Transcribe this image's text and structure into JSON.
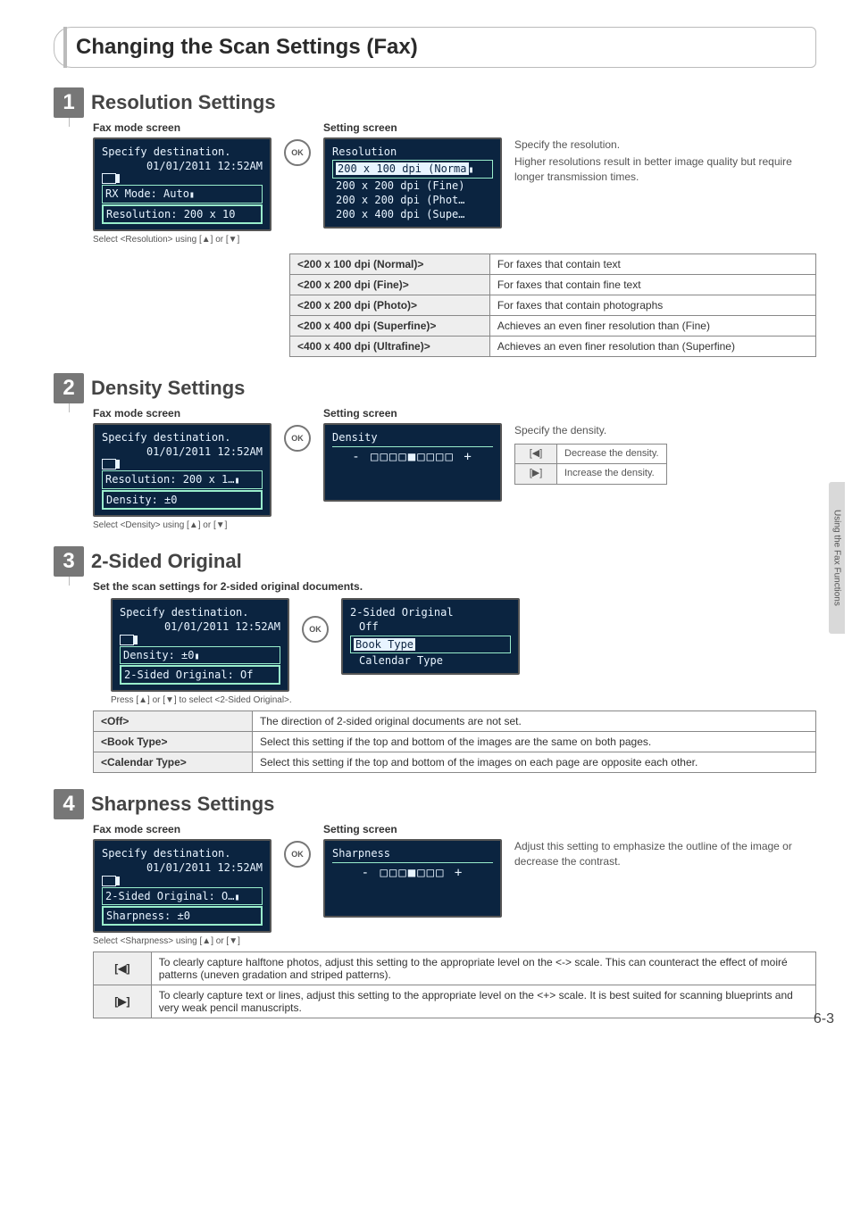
{
  "side_tab": "Using the Fax Functions",
  "page_number": "6-3",
  "main_title": "Changing the Scan Settings (Fax)",
  "steps": {
    "s1": {
      "num": "1",
      "title": "Resolution Settings",
      "fax_label": "Fax mode screen",
      "setting_label": "Setting screen",
      "lcd_fax": {
        "l1": "Specify destination.",
        "l2": "01/01/2011 12:52AM",
        "l3_icon_label": "RX Mode: Auto",
        "l4": "Resolution: 200 x 10"
      },
      "lcd_set": {
        "title": "Resolution",
        "opt1": "200 x 100 dpi (Norma",
        "opt2": "200 x 200 dpi (Fine)",
        "opt3": "200 x 200 dpi (Phot…",
        "opt4": "200 x 400 dpi (Supe…"
      },
      "select_note": "Select <Resolution> using [▲] or [▼]",
      "desc1": "Specify the resolution.",
      "desc2": "Higher resolutions result in better image quality but require longer transmission times.",
      "table": [
        {
          "k": "<200 x 100 dpi (Normal)>",
          "v": "For faxes that contain text"
        },
        {
          "k": "<200 x 200 dpi (Fine)>",
          "v": "For faxes that contain fine text"
        },
        {
          "k": "<200 x 200 dpi (Photo)>",
          "v": "For faxes that contain photographs"
        },
        {
          "k": "<200 x 400 dpi (Superfine)>",
          "v": "Achieves an even finer resolution than (Fine)"
        },
        {
          "k": "<400 x 400 dpi (Ultrafine)>",
          "v": "Achieves an even finer resolution than (Superfine)"
        }
      ]
    },
    "s2": {
      "num": "2",
      "title": "Density Settings",
      "fax_label": "Fax mode screen",
      "setting_label": "Setting screen",
      "lcd_fax": {
        "l1": "Specify destination.",
        "l2": "01/01/2011 12:52AM",
        "l3": "Resolution: 200 x 1…",
        "l4": "Density: ±0"
      },
      "lcd_set": {
        "title": "Density",
        "slider": "- □□□□■□□□□ +"
      },
      "select_note": "Select <Density> using [▲] or [▼]",
      "desc1": "Specify the density.",
      "icon_table": [
        {
          "k": "[◀]",
          "v": "Decrease the density."
        },
        {
          "k": "[▶]",
          "v": "Increase the density."
        }
      ]
    },
    "s3": {
      "num": "3",
      "title": "2-Sided Original",
      "intro": "Set the scan settings for 2-sided original documents.",
      "lcd_fax": {
        "l1": "Specify destination.",
        "l2": "01/01/2011 12:52AM",
        "l3": "Density: ±0",
        "l4": "2-Sided Original: Of"
      },
      "lcd_set": {
        "title": "2-Sided Original",
        "opt1": "Off",
        "opt2": "Book Type",
        "opt3": "Calendar Type"
      },
      "select_note": "Press [▲] or [▼] to select <2-Sided Original>.",
      "table": [
        {
          "k": "<Off>",
          "v": "The direction of 2-sided original documents are not set."
        },
        {
          "k": "<Book Type>",
          "v": "Select this setting if the top and bottom of the images are the same on both pages."
        },
        {
          "k": "<Calendar Type>",
          "v": "Select this setting if the top and bottom of the images on each page are opposite each other."
        }
      ]
    },
    "s4": {
      "num": "4",
      "title": "Sharpness Settings",
      "fax_label": "Fax mode screen",
      "setting_label": "Setting screen",
      "lcd_fax": {
        "l1": "Specify destination.",
        "l2": "01/01/2011 12:52AM",
        "l3": "2-Sided Original: O…",
        "l4": "Sharpness: ±0"
      },
      "lcd_set": {
        "title": "Sharpness",
        "slider": "- □□□■□□□ +"
      },
      "select_note": "Select <Sharpness> using [▲] or [▼]",
      "desc1": "Adjust this setting to emphasize the outline of the image or decrease the contrast.",
      "icon_table": [
        {
          "k": "[◀]",
          "v": "To clearly capture halftone photos, adjust this setting to the appropriate level on the <-> scale. This can counteract the effect of moiré patterns (uneven gradation and striped patterns)."
        },
        {
          "k": "[▶]",
          "v": "To clearly capture text or lines, adjust this setting to the appropriate level on the <+> scale. It is best suited for scanning blueprints and very weak pencil manuscripts."
        }
      ]
    }
  },
  "ok_label": "OK"
}
